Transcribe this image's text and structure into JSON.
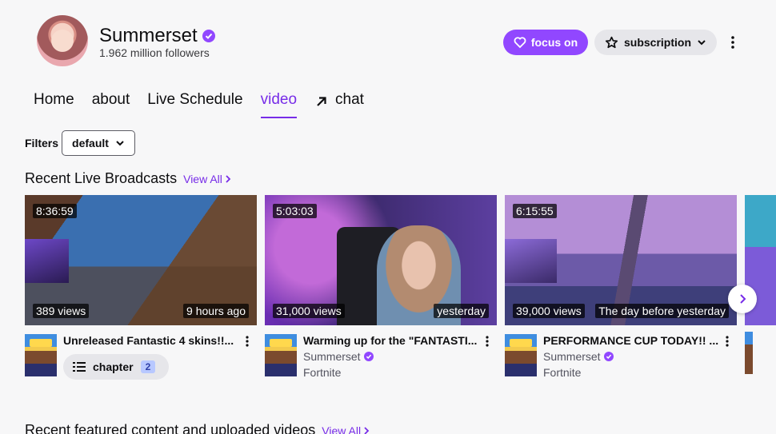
{
  "channel": {
    "name": "Summerset",
    "followers": "1.962 million followers"
  },
  "actions": {
    "follow_label": "focus on",
    "subscribe_label": "subscription"
  },
  "tabs": [
    {
      "label": "Home",
      "active": false
    },
    {
      "label": "about",
      "active": false
    },
    {
      "label": "Live Schedule",
      "active": false
    },
    {
      "label": "video",
      "active": true
    },
    {
      "label": "chat",
      "active": false
    }
  ],
  "filters": {
    "label": "Filters",
    "selected": "default"
  },
  "recent_broadcasts": {
    "title": "Recent Live Broadcasts",
    "view_all": "View All",
    "videos": [
      {
        "duration": "8:36:59",
        "views": "389 views",
        "time": "9 hours ago",
        "title": "Unreleased Fantastic 4 skins!!...",
        "chapter_label": "chapter",
        "chapter_count": "2"
      },
      {
        "duration": "5:03:03",
        "views": "31,000 views",
        "time": "yesterday",
        "title": "Warming up for the \"FANTASTI...",
        "channel": "Summerset",
        "game": "Fortnite"
      },
      {
        "duration": "6:15:55",
        "views": "39,000 views",
        "time": "The day before yesterday",
        "title": "PERFORMANCE CUP TODAY!! ...",
        "channel": "Summerset",
        "game": "Fortnite"
      }
    ]
  },
  "featured": {
    "title": "Recent featured content and uploaded videos",
    "view_all": "View All"
  },
  "colors": {
    "accent": "#9147ff",
    "accent_text": "#772ce8"
  }
}
